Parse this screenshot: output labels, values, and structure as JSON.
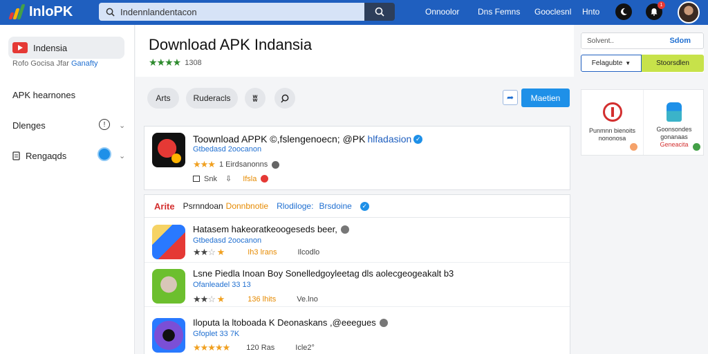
{
  "header": {
    "logo_text": "InloPK",
    "search_value": "Indennlandentacon",
    "nav": [
      "Onnoolor",
      "Dns Femns",
      "Gooclesnl",
      "Hnto"
    ],
    "notification_count": "1"
  },
  "sidebar": {
    "active_label": "Indensia",
    "sub_prefix": "Rofo Gocisa Jfar",
    "sub_link": "Ganafty",
    "items": [
      "APK hearnones",
      "Dlenges",
      "Rengaqds"
    ]
  },
  "main": {
    "title": "Download APK Indansia",
    "rating_text": "1308",
    "chips": [
      "Arts",
      "Ruderacls"
    ],
    "primary_button": "Maetien"
  },
  "right_panel": {
    "input_placeholder": "Solvent..",
    "input_action": "Sdom",
    "select_label": "Felagubte",
    "go_button": "Stoorsdlen",
    "card_items": [
      {
        "line1": "Punmnn bienoits",
        "line2": "nononosa"
      },
      {
        "line1": "Goonsondes",
        "line2": "gonanaas",
        "line3": "Geneacita"
      }
    ]
  },
  "featured": {
    "title_main": "Toownload APPK ©,fslengenoecn; @PK",
    "title_highlight": "hlfadasion",
    "link": "Gtbedasd  2oocanon",
    "rating_label": "1  Eirdsanonns",
    "meta_a": "Snk",
    "meta_b": "Ifsla"
  },
  "list": {
    "header": {
      "brand": "Arite",
      "a": "Psrnndoan",
      "b": "Donnbnotie",
      "c": "Rlodiloge:",
      "d": "Brsdoine"
    },
    "rows": [
      {
        "title": "Hatasem hakeoratkeoogeseds beer,",
        "link": "Gtbedasd  2oocanon",
        "size": "Ih3 lrans",
        "extra": "Ilcodlo"
      },
      {
        "title": "Lsne Piedla Inoan Boy Sonelledgoyleetag dls aolecgeogeakalt b3",
        "link": "Ofanleadel  33 13",
        "size": "136 lhits",
        "extra": "Ve.lno"
      },
      {
        "title": "Iloputa la ltoboada K Deonaskans ,@eeegues",
        "link": "Gfoplet  33 7K",
        "size": "120 Ras",
        "extra": "Icle2°"
      }
    ]
  },
  "colors": {
    "brand_blue": "#1f5fbf",
    "accent_blue": "#1e90e8",
    "lime": "#c7e24a",
    "star_orange": "#f0a020",
    "star_green": "#2e8b2e"
  }
}
